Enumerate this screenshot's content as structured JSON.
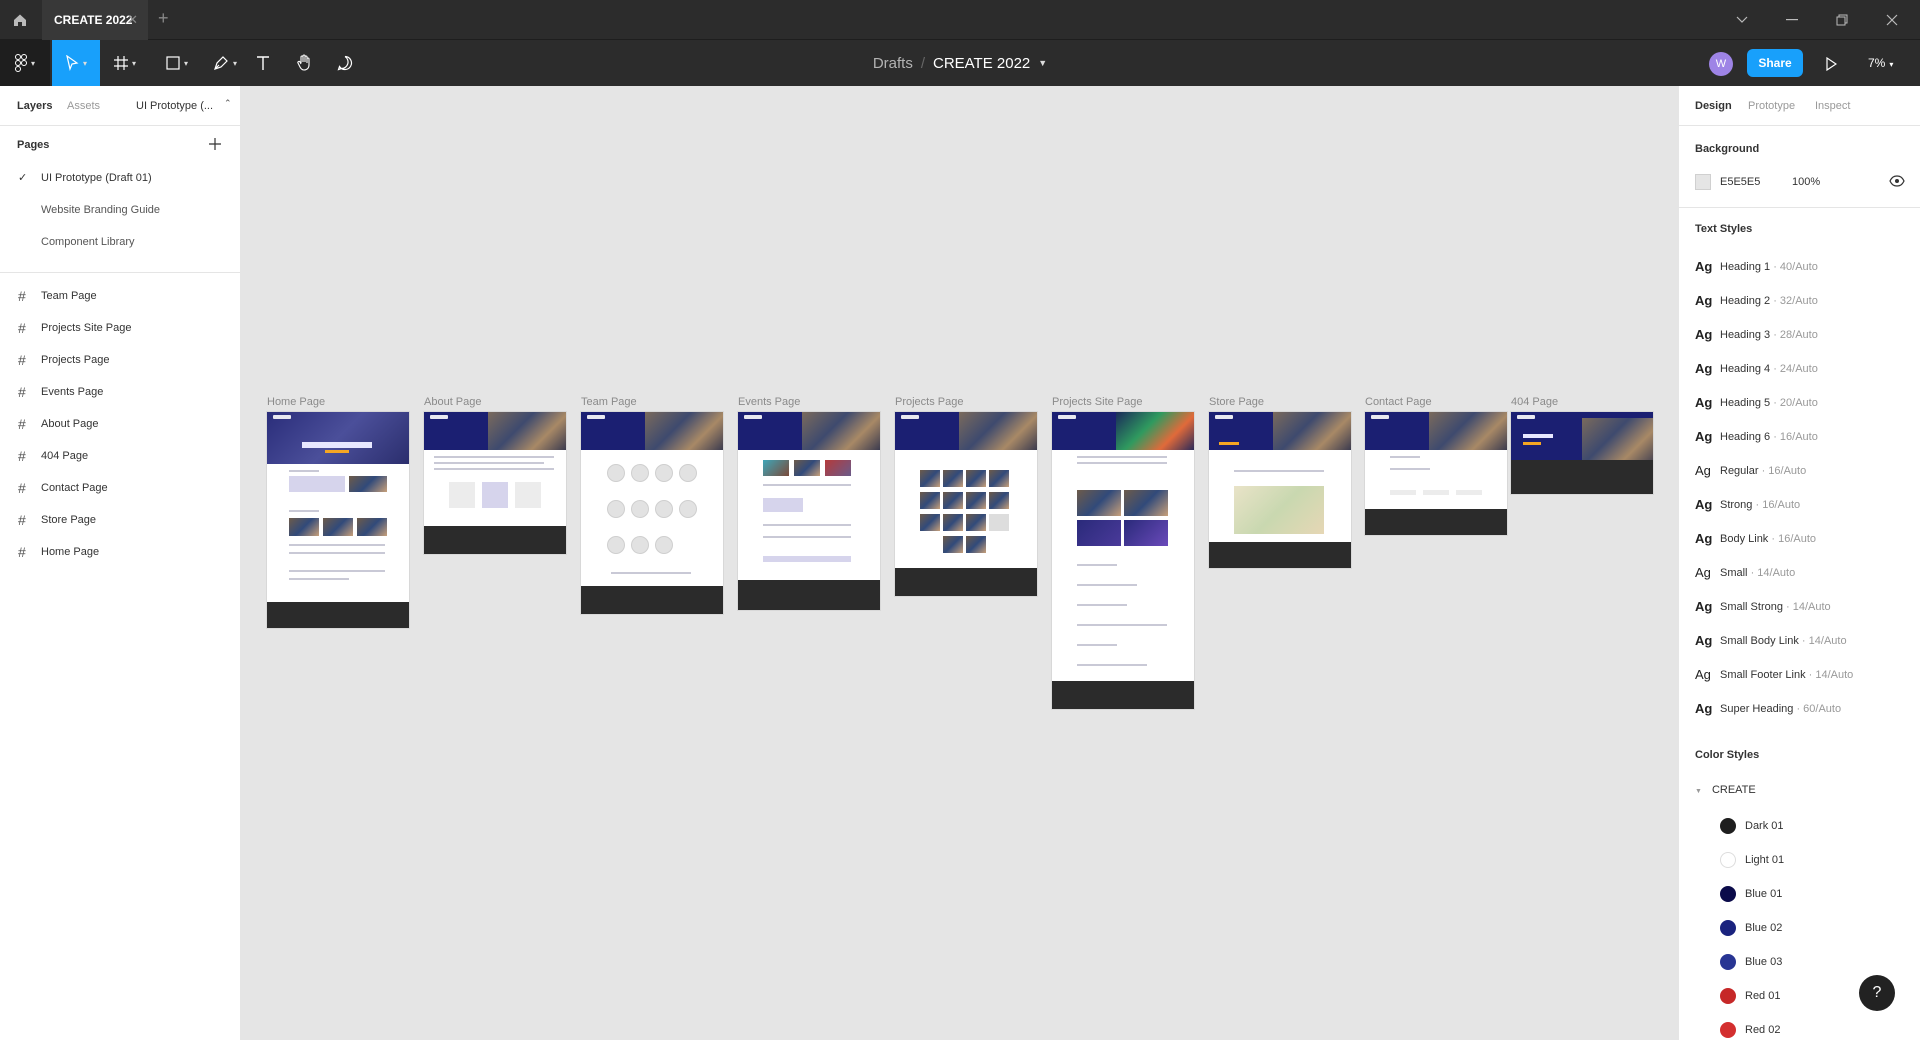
{
  "titlebar": {
    "tab_title": "CREATE 2022",
    "tab_close": "✕",
    "new_tab": "+"
  },
  "toolbar": {
    "breadcrumb_parent": "Drafts",
    "breadcrumb_sep": "/",
    "breadcrumb_file": "CREATE 2022",
    "avatar_initial": "W",
    "share_label": "Share",
    "zoom": "7%"
  },
  "left_panel": {
    "tabs": [
      "Layers",
      "Assets",
      "UI Prototype (..."
    ],
    "pages_heading": "Pages",
    "pages": [
      {
        "label": "UI Prototype (Draft 01)",
        "selected": true
      },
      {
        "label": "Website Branding Guide",
        "selected": false
      },
      {
        "label": "Component Library",
        "selected": false
      }
    ],
    "layers": [
      "Team Page",
      "Projects Site Page",
      "Projects Page",
      "Events Page",
      "About Page",
      "404 Page",
      "Contact Page",
      "Store Page",
      "Home Page"
    ]
  },
  "canvas": {
    "background": "#E5E5E5",
    "frames": [
      "Home Page",
      "About Page",
      "Team Page",
      "Events Page",
      "Projects Page",
      "Projects Site Page",
      "Store Page",
      "Contact Page",
      "404 Page"
    ]
  },
  "right_panel": {
    "tabs": [
      "Design",
      "Prototype",
      "Inspect"
    ],
    "background_heading": "Background",
    "background_hex": "E5E5E5",
    "background_opacity": "100%",
    "text_styles_heading": "Text Styles",
    "text_styles": [
      {
        "name": "Heading 1",
        "meta": " · 40/Auto",
        "bold": true
      },
      {
        "name": "Heading 2",
        "meta": " · 32/Auto",
        "bold": true
      },
      {
        "name": "Heading 3",
        "meta": " · 28/Auto",
        "bold": true
      },
      {
        "name": "Heading 4",
        "meta": " · 24/Auto",
        "bold": true
      },
      {
        "name": "Heading 5",
        "meta": " · 20/Auto",
        "bold": true
      },
      {
        "name": "Heading 6",
        "meta": " · 16/Auto",
        "bold": true
      },
      {
        "name": "Regular",
        "meta": " · 16/Auto",
        "bold": false
      },
      {
        "name": "Strong",
        "meta": " · 16/Auto",
        "bold": true
      },
      {
        "name": "Body Link",
        "meta": " · 16/Auto",
        "bold": true
      },
      {
        "name": "Small",
        "meta": " · 14/Auto",
        "bold": false
      },
      {
        "name": "Small Strong",
        "meta": " · 14/Auto",
        "bold": true
      },
      {
        "name": "Small Body Link",
        "meta": " · 14/Auto",
        "bold": true
      },
      {
        "name": "Small Footer Link",
        "meta": " · 14/Auto",
        "bold": false
      },
      {
        "name": "Super Heading",
        "meta": " · 60/Auto",
        "bold": true
      }
    ],
    "color_styles_heading": "Color Styles",
    "color_group": "CREATE",
    "colors": [
      {
        "name": "Dark 01",
        "hex": "#1e1e1e"
      },
      {
        "name": "Light 01",
        "hex": "#ffffff"
      },
      {
        "name": "Blue 01",
        "hex": "#0b0b4a"
      },
      {
        "name": "Blue 02",
        "hex": "#1a237e"
      },
      {
        "name": "Blue 03",
        "hex": "#283593"
      },
      {
        "name": "Red 01",
        "hex": "#c62828"
      },
      {
        "name": "Red 02",
        "hex": "#d32f2f"
      }
    ]
  },
  "help_label": "?"
}
